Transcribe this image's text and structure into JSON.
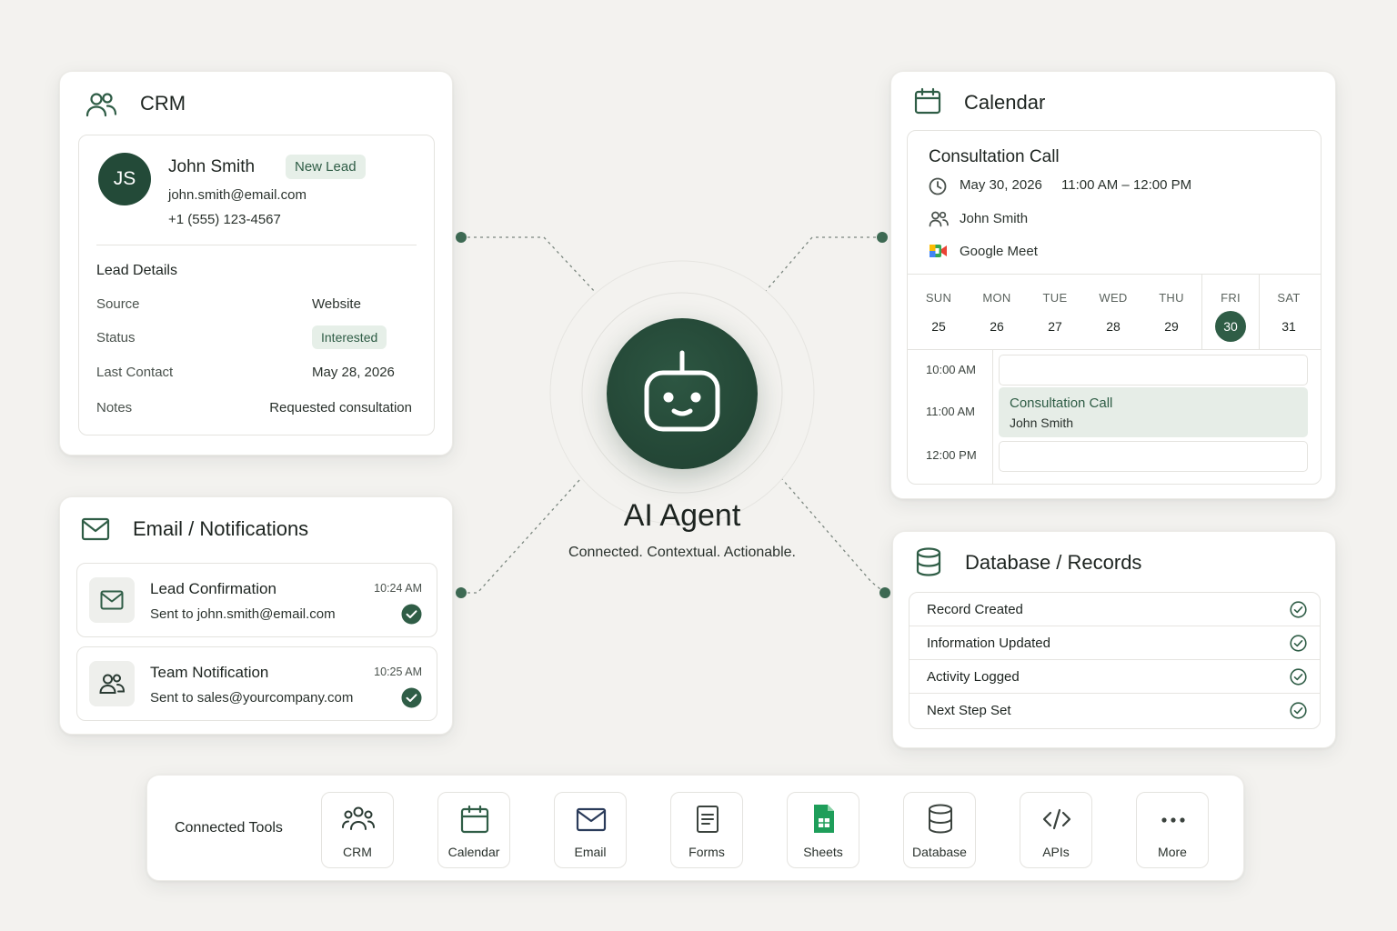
{
  "crm": {
    "title": "CRM",
    "contact": {
      "initials": "JS",
      "name": "John Smith",
      "badge": "New Lead",
      "email": "john.smith@email.com",
      "phone": "+1 (555) 123-4567"
    },
    "details_heading": "Lead Details",
    "details": [
      {
        "label": "Source",
        "value": "Website"
      },
      {
        "label": "Status",
        "value": "Interested"
      },
      {
        "label": "Last Contact",
        "value": "May 28, 2026"
      },
      {
        "label": "Notes",
        "value": "Requested consultation"
      }
    ]
  },
  "email": {
    "title": "Email / Notifications",
    "items": [
      {
        "title": "Lead Confirmation",
        "subtitle": "Sent to john.smith@email.com",
        "time": "10:24 AM",
        "icon": "mail-icon"
      },
      {
        "title": "Team Notification",
        "subtitle": "Sent to sales@yourcompany.com",
        "time": "10:25 AM",
        "icon": "users-icon"
      }
    ]
  },
  "agent": {
    "title": "AI Agent",
    "tagline": "Connected. Contextual. Actionable."
  },
  "calendar": {
    "title": "Calendar",
    "event": {
      "title": "Consultation Call",
      "date": "May 30, 2026",
      "time": "11:00 AM – 12:00 PM",
      "attendee": "John Smith",
      "location": "Google Meet"
    },
    "days": [
      {
        "name": "SUN",
        "num": "25"
      },
      {
        "name": "MON",
        "num": "26"
      },
      {
        "name": "TUE",
        "num": "27"
      },
      {
        "name": "WED",
        "num": "28"
      },
      {
        "name": "THU",
        "num": "29"
      },
      {
        "name": "FRI",
        "num": "30",
        "selected": true
      },
      {
        "name": "SAT",
        "num": "31"
      }
    ],
    "times": [
      "10:00 AM",
      "11:00 AM",
      "12:00 PM"
    ],
    "slot_event": {
      "title": "Consultation Call",
      "subtitle": "John Smith"
    }
  },
  "database": {
    "title": "Database / Records",
    "rows": [
      "Record Created",
      "Information Updated",
      "Activity Logged",
      "Next Step Set"
    ]
  },
  "tools": {
    "label": "Connected Tools",
    "items": [
      {
        "label": "CRM",
        "icon": "users-icon"
      },
      {
        "label": "Calendar",
        "icon": "calendar-icon"
      },
      {
        "label": "Email",
        "icon": "mail-icon"
      },
      {
        "label": "Forms",
        "icon": "document-icon"
      },
      {
        "label": "Sheets",
        "icon": "sheets-icon"
      },
      {
        "label": "Database",
        "icon": "database-icon"
      },
      {
        "label": "APIs",
        "icon": "code-icon"
      },
      {
        "label": "More",
        "icon": "more-icon"
      }
    ]
  },
  "colors": {
    "accent": "#2f5d46",
    "accent_dark": "#234a38",
    "badge_bg": "#e6efe8",
    "background": "#f3f2ef"
  }
}
